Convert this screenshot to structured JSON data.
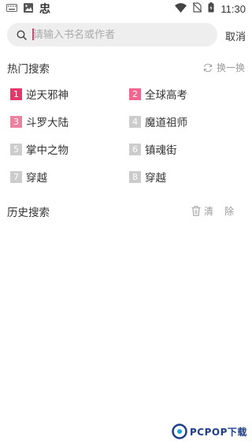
{
  "status_bar": {
    "time": "11:30",
    "left_icons": [
      "keyboard-icon",
      "image-icon",
      "app-icon"
    ],
    "app_icon_char": "忠",
    "right_icons": [
      "wifi-icon",
      "no-sim-icon",
      "battery-icon"
    ]
  },
  "search": {
    "placeholder": "请输入书名或作者",
    "value": "",
    "cancel_label": "取消"
  },
  "hot_search": {
    "title": "热门搜索",
    "refresh_label": "换一换",
    "items": [
      {
        "rank": "1",
        "title": "逆天邪神",
        "color": "#e8356a"
      },
      {
        "rank": "2",
        "title": "全球高考",
        "color": "#f0668f"
      },
      {
        "rank": "3",
        "title": "斗罗大陆",
        "color": "#f17f9f"
      },
      {
        "rank": "4",
        "title": "魔道祖师",
        "color": "#cccccc"
      },
      {
        "rank": "5",
        "title": "掌中之物",
        "color": "#cccccc"
      },
      {
        "rank": "6",
        "title": "镇魂街",
        "color": "#cccccc"
      },
      {
        "rank": "7",
        "title": "穿越",
        "color": "#cccccc"
      },
      {
        "rank": "8",
        "title": "穿越",
        "color": "#cccccc"
      }
    ]
  },
  "history_search": {
    "title": "历史搜索",
    "clear_label": "清除"
  },
  "watermark": {
    "text": "PCPOP下载"
  },
  "colors": {
    "accent": "#e3436d",
    "search_bg": "#eeeeee",
    "muted_text": "#999999"
  }
}
